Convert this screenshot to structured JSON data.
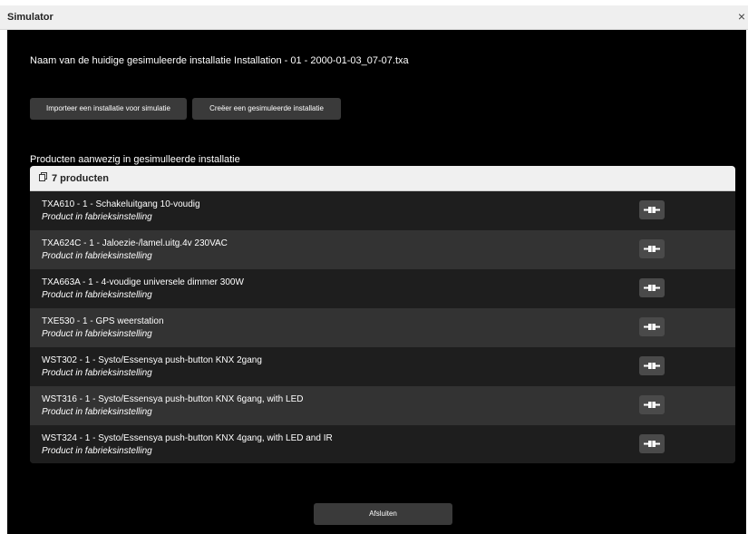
{
  "window": {
    "title": "Simulator",
    "close_glyph": "×"
  },
  "installation": {
    "name_text": "Naam van de huidige gesimuleerde installatie Installation - 01 - 2000-01-03_07-07.txa"
  },
  "buttons": {
    "import_label": "Importeer een installatie voor simulatie",
    "create_label": "Creëer een gesimuleerde installatie",
    "close_label": "Afsluiten"
  },
  "products_section": {
    "label": "Producten aanwezig in gesimulleerde installatie",
    "count_label": "7 producten",
    "items": [
      {
        "name": "TXA610 - 1 - Schakeluitgang 10-voudig",
        "status": "Product in fabrieksinstelling"
      },
      {
        "name": "TXA624C - 1 - Jaloezie-/lamel.uitg.4v 230VAC",
        "status": "Product in fabrieksinstelling"
      },
      {
        "name": "TXA663A - 1 - 4-voudige universele dimmer 300W",
        "status": "Product in fabrieksinstelling"
      },
      {
        "name": "TXE530 - 1 - GPS weerstation",
        "status": "Product in fabrieksinstelling"
      },
      {
        "name": "WST302 - 1 - Systo/Essensya push-button KNX 2gang",
        "status": "Product in fabrieksinstelling"
      },
      {
        "name": "WST316 - 1 - Systo/Essensya push-button KNX 6gang, with LED",
        "status": "Product in fabrieksinstelling"
      },
      {
        "name": "WST324 - 1 - Systo/Essensya push-button KNX 4gang, with LED and IR",
        "status": "Product in fabrieksinstelling"
      }
    ]
  },
  "icons": {
    "header": "box-icon",
    "row_action": "plug-icon"
  }
}
